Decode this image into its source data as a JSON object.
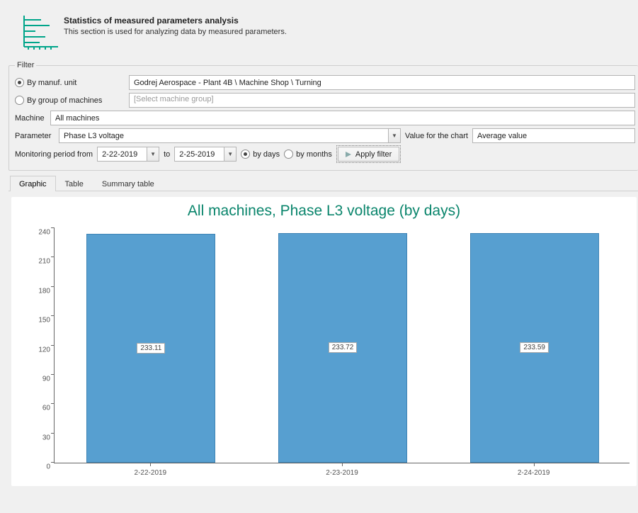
{
  "header": {
    "title": "Statistics of measured parameters analysis",
    "subtitle": "This section is used for analyzing data by measured parameters."
  },
  "filter": {
    "legend": "Filter",
    "by_manuf_label": "By manuf. unit",
    "by_manuf_value": "Godrej Aerospace - Plant 4B \\ Machine Shop \\ Turning",
    "by_group_label": "By group of machines",
    "by_group_placeholder": "[Select machine group]",
    "machine_label": "Machine",
    "machine_value": "All machines",
    "parameter_label": "Parameter",
    "parameter_value": "Phase L3 voltage",
    "value_for_chart_label": "Value for the chart",
    "value_for_chart_value": "Average value",
    "period_from_label": "Monitoring period from",
    "period_from": "2-22-2019",
    "period_to_label": "to",
    "period_to": "2-25-2019",
    "by_days_label": "by days",
    "by_months_label": "by months",
    "apply_label": "Apply filter"
  },
  "tabs": {
    "items": [
      {
        "label": "Graphic",
        "active": true
      },
      {
        "label": "Table",
        "active": false
      },
      {
        "label": "Summary table",
        "active": false
      }
    ]
  },
  "chart": {
    "title": "All machines, Phase L3 voltage (by days)"
  },
  "chart_data": {
    "type": "bar",
    "title": "All machines, Phase L3 voltage (by days)",
    "categories": [
      "2-22-2019",
      "2-23-2019",
      "2-24-2019"
    ],
    "values": [
      233.11,
      233.72,
      233.59
    ],
    "xlabel": "",
    "ylabel": "",
    "ylim": [
      0,
      240
    ],
    "yticks": [
      0,
      30,
      60,
      90,
      120,
      150,
      180,
      210,
      240
    ]
  }
}
